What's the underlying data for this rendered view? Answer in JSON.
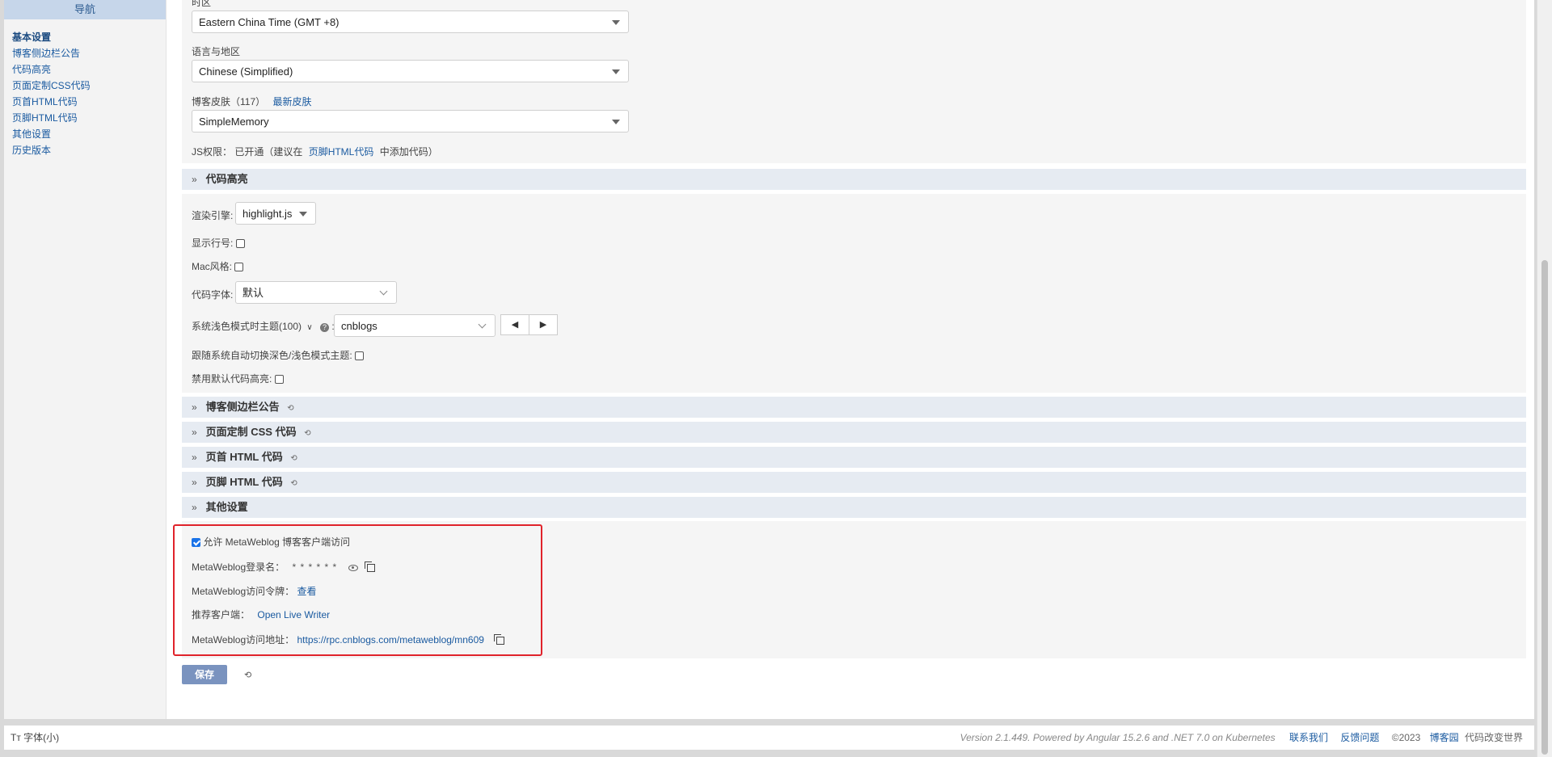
{
  "sidebar": {
    "title": "导航",
    "items": [
      {
        "label": "基本设置",
        "active": true
      },
      {
        "label": "博客侧边栏公告"
      },
      {
        "label": "代码高亮"
      },
      {
        "label": "页面定制CSS代码"
      },
      {
        "label": "页首HTML代码"
      },
      {
        "label": "页脚HTML代码"
      },
      {
        "label": "其他设置"
      },
      {
        "label": "历史版本"
      }
    ]
  },
  "basic": {
    "timezone_label": "时区",
    "timezone_value": "Eastern China Time (GMT +8)",
    "language_label": "语言与地区",
    "language_value": "Chinese (Simplified)",
    "skin_label": "博客皮肤（117）",
    "skin_link": "最新皮肤",
    "skin_value": "SimpleMemory",
    "js_prefix": "JS权限： 已开通（建议在",
    "js_link": "页脚HTML代码",
    "js_suffix": "中添加代码）"
  },
  "code_highlight": {
    "title": "代码高亮",
    "engine_label": "渲染引擎:",
    "engine_value": "highlight.js",
    "line_numbers_label": "显示行号:",
    "mac_style_label": "Mac风格:",
    "font_label": "代码字体:",
    "font_value": "默认",
    "light_theme_label": "系统浅色模式时主题(100)",
    "light_theme_value": "cnblogs",
    "auto_switch_label": "跟随系统自动切换深色/浅色模式主题:",
    "disable_default_label": "禁用默认代码高亮:"
  },
  "sections": [
    {
      "title": "博客侧边栏公告"
    },
    {
      "title": "页面定制 CSS 代码"
    },
    {
      "title": "页首 HTML 代码"
    },
    {
      "title": "页脚 HTML 代码"
    }
  ],
  "other": {
    "title": "其他设置",
    "allow_label": "允许 MetaWeblog 博客客户端访问",
    "login_label": "MetaWeblog登录名：",
    "login_value": "* * * * * *",
    "token_label": "MetaWeblog访问令牌：",
    "token_link": "查看",
    "client_label": "推荐客户端：",
    "client_link": "Open Live Writer",
    "url_label": "MetaWeblog访问地址：",
    "url_value": "https://rpc.cnblogs.com/metaweblog/mn609"
  },
  "save_label": "保存",
  "footer": {
    "font_size": "Tт 字体(小)",
    "version": "Version 2.1.449. Powered by Angular 15.2.6 and .NET 7.0 on Kubernetes",
    "contact": "联系我们",
    "feedback": "反馈问题",
    "copyright": "©2023",
    "brand": "博客园",
    "slogan": "代码改变世界"
  },
  "colors": {
    "accent": "#1a5aa0",
    "highlight_border": "#e0232b",
    "section_bg": "#e6ebf2"
  }
}
